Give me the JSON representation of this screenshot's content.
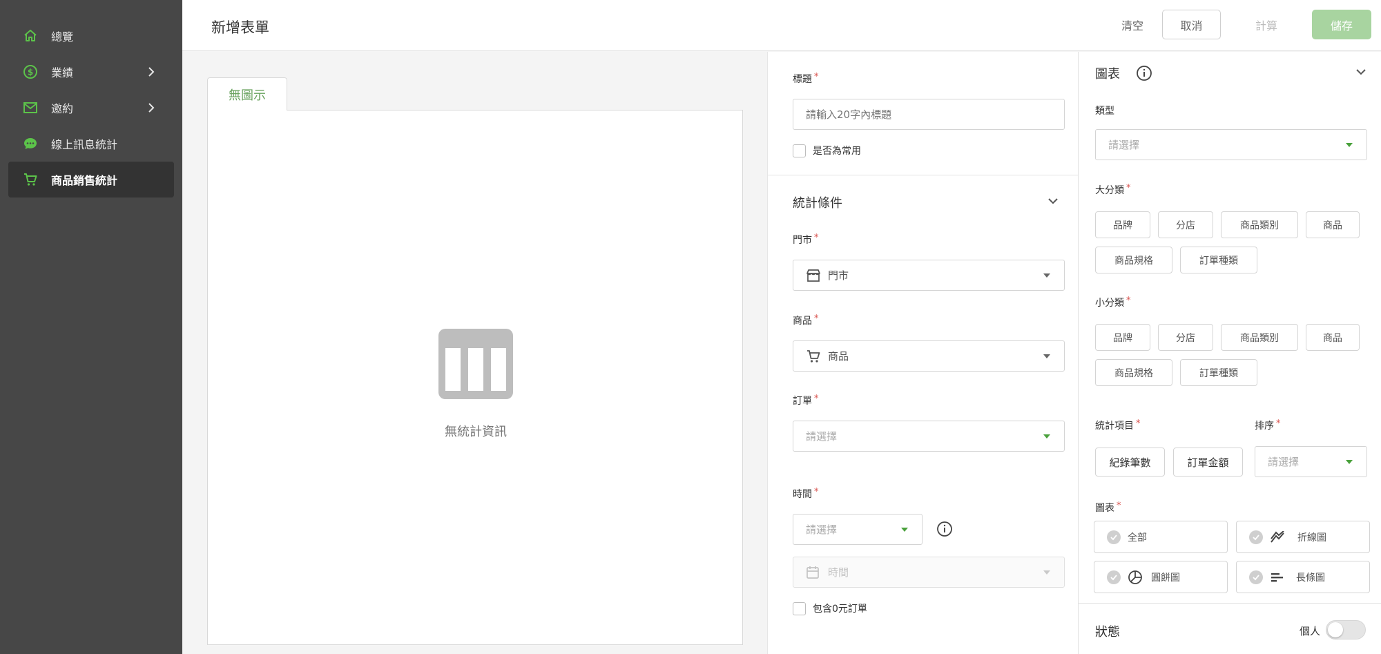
{
  "sidebar": {
    "items": [
      {
        "label": "總覽",
        "icon": "home-icon"
      },
      {
        "label": "業績",
        "icon": "dollar-icon"
      },
      {
        "label": "邀約",
        "icon": "mail-icon"
      },
      {
        "label": "線上訊息統計",
        "icon": "chat-icon"
      },
      {
        "label": "商品銷售統計",
        "icon": "cart-icon",
        "active": true
      }
    ]
  },
  "header": {
    "title": "新增表單",
    "clear": "清空",
    "cancel": "取消",
    "calculate": "計算",
    "save": "儲存"
  },
  "preview": {
    "tab": "無圖示",
    "empty_text": "無統計資訊"
  },
  "form": {
    "title_label": "標題",
    "title_placeholder": "請輸入20字內標題",
    "common_label": "是否為常用",
    "conditions_title": "統計條件",
    "store_label": "門市",
    "store_value": "門市",
    "product_label": "商品",
    "product_value": "商品",
    "order_label": "訂單",
    "order_placeholder": "請選擇",
    "time_label": "時間",
    "time_placeholder": "請選擇",
    "time_value": "時間",
    "zero_order_label": "包含0元訂單"
  },
  "chart_panel": {
    "title": "圖表",
    "type_label": "類型",
    "type_placeholder": "請選擇",
    "major_label": "大分類",
    "major_options": [
      "品牌",
      "分店",
      "商品類別",
      "商品",
      "商品規格",
      "訂單種類"
    ],
    "minor_label": "小分類",
    "minor_options": [
      "品牌",
      "分店",
      "商品類別",
      "商品",
      "商品規格",
      "訂單種類"
    ],
    "stat_label": "統計項目",
    "stat_options": [
      "紀錄筆數",
      "訂單金額"
    ],
    "sort_label": "排序",
    "sort_placeholder": "請選擇",
    "chart_label": "圖表",
    "chart_options": [
      "全部",
      "折線圖",
      "圓餅圖",
      "長條圖"
    ],
    "status_title": "狀態",
    "personal_label": "個人"
  },
  "colors": {
    "accent": "#4aa13c",
    "sidebar_bg": "#474747",
    "save_bg": "#a8d4a0",
    "required": "#d9534f"
  }
}
